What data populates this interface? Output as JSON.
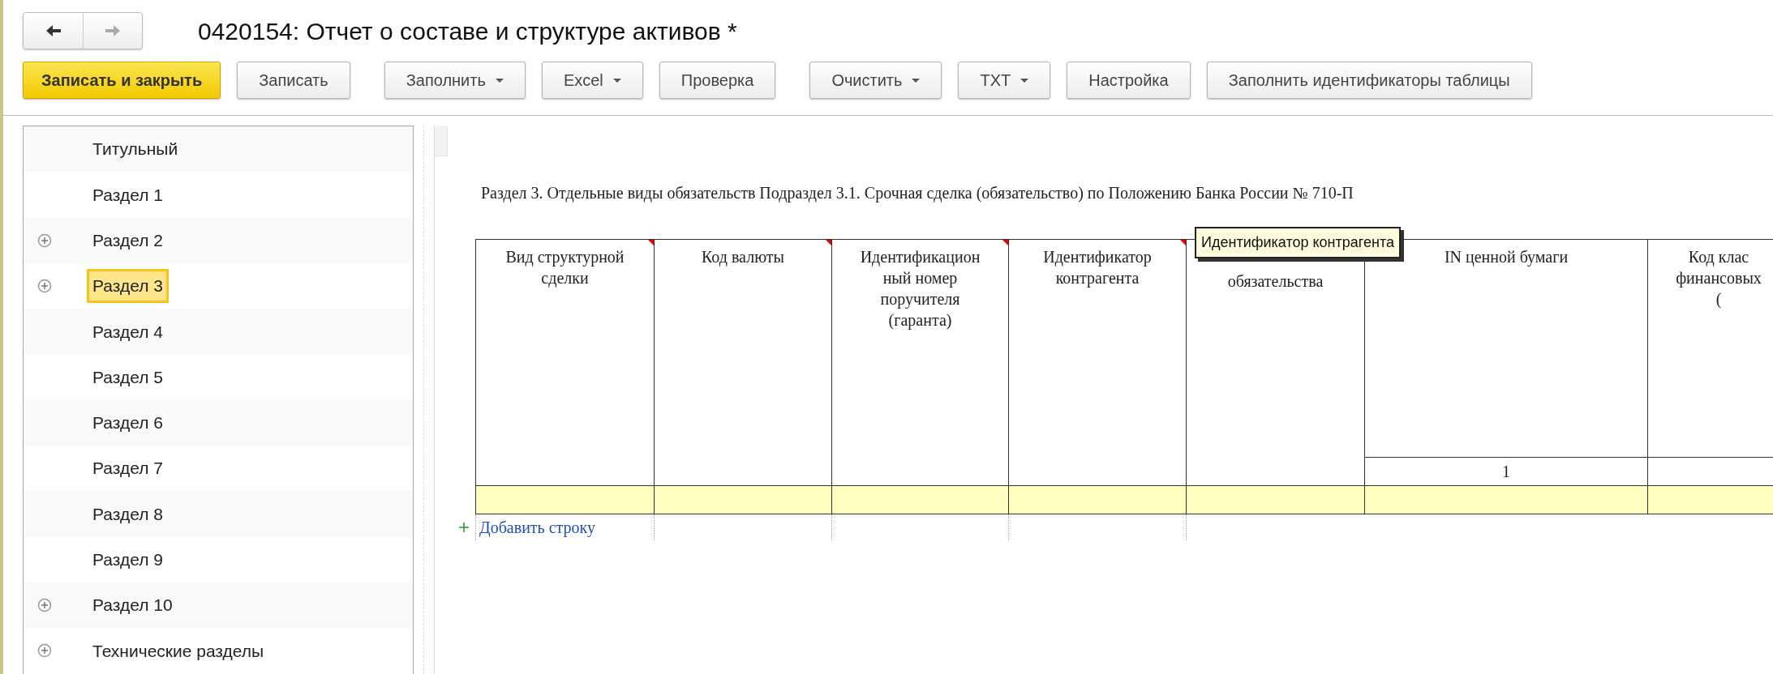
{
  "window": {
    "title": "0420154: Отчет о составе и структуре активов *",
    "nav": [
      {
        "kind": "back",
        "disabled": false
      },
      {
        "kind": "forward",
        "disabled": true
      }
    ]
  },
  "toolbar_groups": [
    [
      {
        "label": "Записать и закрыть",
        "kind": "primary"
      },
      {
        "label": "Записать",
        "kind": "plain"
      }
    ],
    [
      {
        "label": "Заполнить",
        "kind": "dropdown"
      },
      {
        "label": "Excel",
        "kind": "dropdown"
      },
      {
        "label": "Проверка",
        "kind": "plain"
      }
    ],
    [
      {
        "label": "Очистить",
        "kind": "dropdown"
      },
      {
        "label": "TXT",
        "kind": "dropdown"
      },
      {
        "label": "Настройка",
        "kind": "plain"
      },
      {
        "label": "Заполнить идентификаторы таблицы",
        "kind": "plain"
      }
    ]
  ],
  "sidebar": {
    "items": [
      {
        "label": "Титульный",
        "expandable": false,
        "selected": false
      },
      {
        "label": "Раздел 1",
        "expandable": false,
        "selected": false
      },
      {
        "label": "Раздел 2",
        "expandable": true,
        "selected": false
      },
      {
        "label": "Раздел 3",
        "expandable": true,
        "selected": true
      },
      {
        "label": "Раздел 4",
        "expandable": false,
        "selected": false
      },
      {
        "label": "Раздел 5",
        "expandable": false,
        "selected": false
      },
      {
        "label": "Раздел 6",
        "expandable": false,
        "selected": false
      },
      {
        "label": "Раздел 7",
        "expandable": false,
        "selected": false
      },
      {
        "label": "Раздел 8",
        "expandable": false,
        "selected": false
      },
      {
        "label": "Раздел 9",
        "expandable": false,
        "selected": false
      },
      {
        "label": "Раздел 10",
        "expandable": true,
        "selected": false
      },
      {
        "label": "Технические разделы",
        "expandable": true,
        "selected": false
      }
    ]
  },
  "report": {
    "caption": "Раздел 3. Отдельные виды обязательств Подраздел 3.1. Срочная сделка (обязательство) по Положению Банка России № 710-П",
    "columns": [
      {
        "lines": [
          "Вид структурной",
          "сделки"
        ],
        "note": true,
        "number": false
      },
      {
        "lines": [
          "Код валюты"
        ],
        "note": true,
        "number": false
      },
      {
        "lines": [
          "Идентификацион",
          "ный номер",
          "поручителя",
          "(гаранта)"
        ],
        "note": true,
        "number": false
      },
      {
        "lines": [
          "Идентификатор",
          "контрагента"
        ],
        "note": true,
        "number": false
      },
      {
        "lines": [
          "обязательства"
        ],
        "note": false,
        "number": false,
        "covered": true
      },
      {
        "lines": [
          "IN ценной бумаги"
        ],
        "note": false,
        "number": true,
        "number_text": "1"
      },
      {
        "lines": [
          "Код клас",
          "финансовых",
          "("
        ],
        "note": false,
        "number": true
      }
    ],
    "add_row": "Добавить строку",
    "tooltip": "Идентификатор контрагента"
  }
}
